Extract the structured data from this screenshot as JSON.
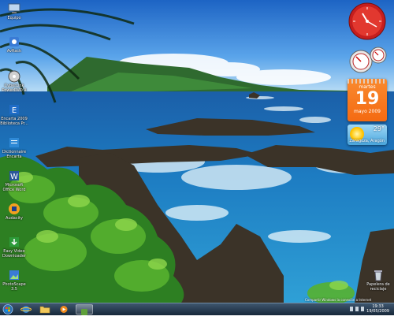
{
  "desktop": {
    "icons": [
      {
        "label": "Equipo",
        "icon": "computer-icon"
      },
      {
        "label": "AvRack",
        "icon": "app-icon"
      },
      {
        "label": "CyberLink PowerDVD 9",
        "icon": "dvd-icon"
      },
      {
        "label": "Encarta 2009 Biblioteca Pr...",
        "icon": "encarta-icon"
      },
      {
        "label": "Dictionnaire Encarta",
        "icon": "dictionary-icon"
      },
      {
        "label": "Microsoft Office Word",
        "icon": "word-icon"
      },
      {
        "label": "Audacity",
        "icon": "audio-icon"
      },
      {
        "label": "Easy Video Downloader",
        "icon": "download-icon"
      },
      {
        "label": "PhotoScape 3.5",
        "icon": "photo-icon"
      }
    ],
    "recycle_bin": {
      "label": "Papelera de reciclaje",
      "icon": "recycle-bin-icon"
    },
    "overlay_text": "Compartir Windows la conexión a Internet"
  },
  "gadgets": {
    "calendar": {
      "dow": "martes",
      "day": "19",
      "month": "mayo 2009"
    },
    "weather": {
      "temp": "29°",
      "city": "Zaragoza, Aragón"
    }
  },
  "taskbar": {
    "buttons": [
      {
        "name": "start-orb",
        "icon": "windows-icon"
      },
      {
        "name": "taskbar-ie",
        "icon": "internet-explorer-icon"
      },
      {
        "name": "taskbar-explorer",
        "icon": "folder-icon"
      },
      {
        "name": "taskbar-media-player",
        "icon": "media-player-icon"
      },
      {
        "name": "taskbar-app",
        "icon": "app-icon"
      }
    ],
    "time": "19:33",
    "date": "19/05/2009"
  }
}
